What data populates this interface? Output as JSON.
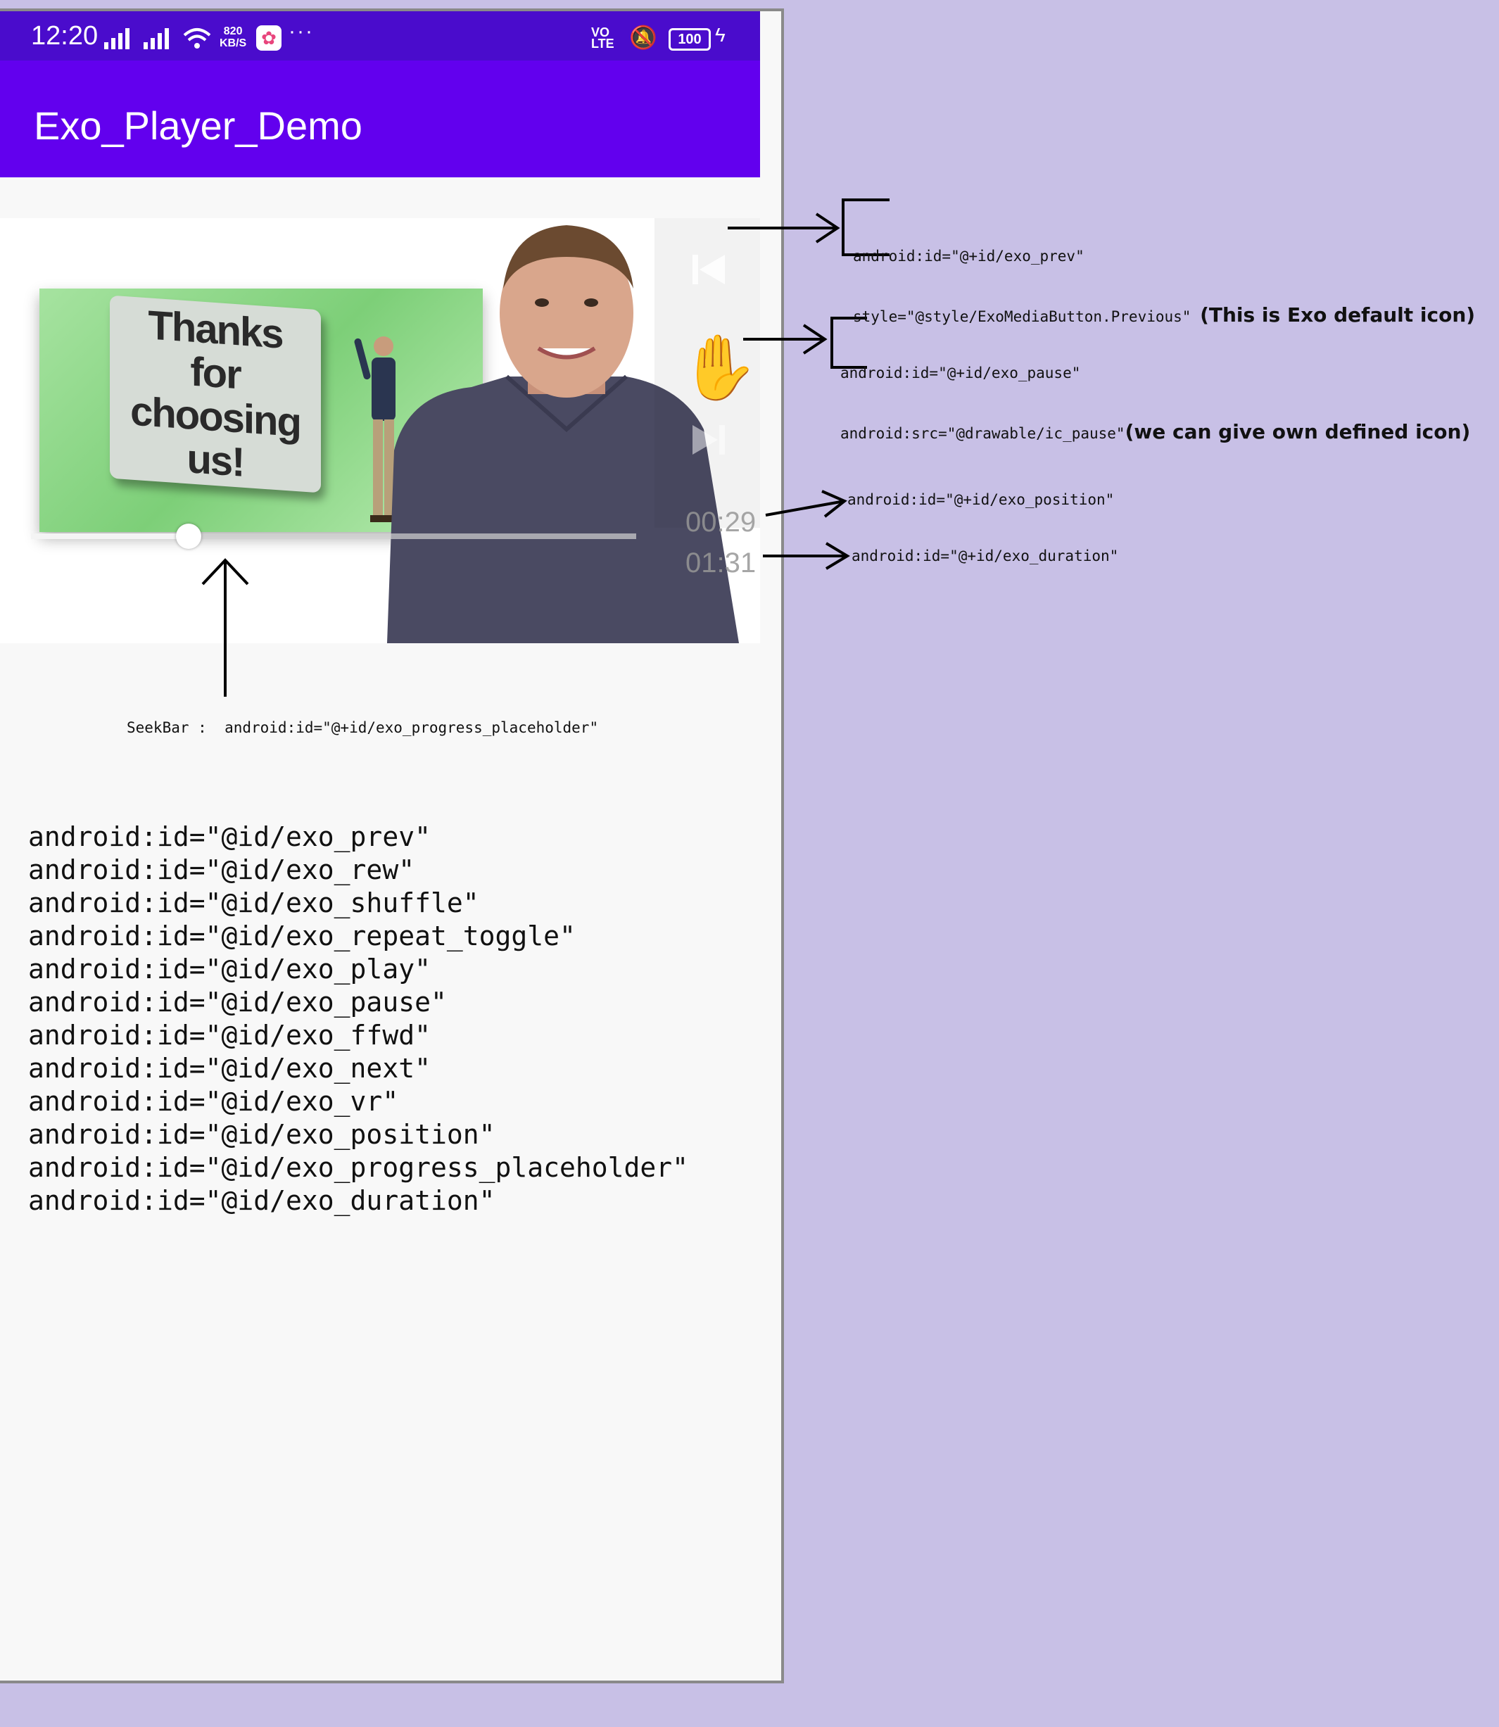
{
  "status_bar": {
    "time": "12:20",
    "net_speed_value": "820",
    "net_speed_unit": "KB/S",
    "more": "···",
    "volte_top": "VO",
    "volte_bottom": "LTE",
    "battery": "100"
  },
  "app_bar": {
    "title": "Exo_Player_Demo"
  },
  "player": {
    "slide_text": "Thanks for choosing us!",
    "position": "00:29",
    "duration": "01:31",
    "progress": 0.26
  },
  "seekbar_label": "SeekBar :  android:id=\"@+id/exo_progress_placeholder\"",
  "id_list": [
    "android:id=\"@id/exo_prev\"",
    "android:id=\"@id/exo_rew\"",
    "android:id=\"@id/exo_shuffle\"",
    "android:id=\"@id/exo_repeat_toggle\"",
    "android:id=\"@id/exo_play\"",
    "android:id=\"@id/exo_pause\"",
    "android:id=\"@id/exo_ffwd\"",
    "android:id=\"@id/exo_next\"",
    "android:id=\"@id/exo_vr\"",
    "android:id=\"@id/exo_position\"",
    "android:id=\"@id/exo_progress_placeholder\"",
    "android:id=\"@id/exo_duration\""
  ],
  "annotations": {
    "prev_line1": "android:id=\"@+id/exo_prev\"",
    "prev_line2": "style=\"@style/ExoMediaButton.Previous\"",
    "prev_note": "(This is Exo default icon)",
    "pause_line1": "android:id=\"@+id/exo_pause\"",
    "pause_line2": "android:src=\"@drawable/ic_pause\"",
    "pause_note": "(we can give own defined icon)",
    "position": "android:id=\"@+id/exo_position\"",
    "duration": "android:id=\"@+id/exo_duration\""
  },
  "icons": {
    "prev": "skip-previous-icon",
    "pause": "raised-hand-icon",
    "next": "skip-next-icon",
    "nav_hide": "chevron-down-icon",
    "nav_recents": "square-icon",
    "nav_home": "circle-icon",
    "nav_back": "triangle-back-icon"
  },
  "colors": {
    "status_bar": "#4a0ccc",
    "app_bar": "#6200ee",
    "page_bg": "#c8c0e6"
  }
}
